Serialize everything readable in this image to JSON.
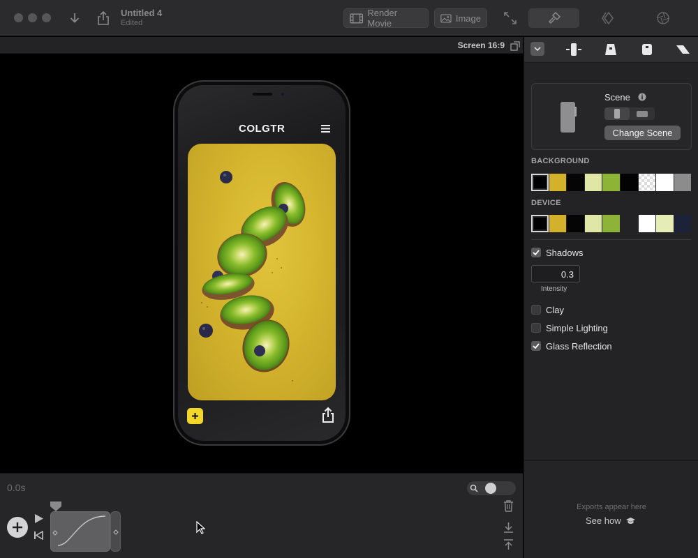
{
  "window": {
    "title": "Untitled 4",
    "status": "Edited"
  },
  "toolbar": {
    "render_movie_label": "Render Movie",
    "image_label": "Image"
  },
  "canvas": {
    "aspect_label": "Screen 16:9"
  },
  "app_preview": {
    "logo_text": "COLGTR"
  },
  "timeline": {
    "time": "0.0s"
  },
  "sidebar": {
    "scene_label": "Scene",
    "change_scene_label": "Change Scene",
    "background_title": "BACKGROUND",
    "device_title": "DEVICE",
    "background_swatches": [
      "#000000",
      "#d4b12a",
      "#050505",
      "#dfe6a6",
      "#8db337",
      "#030303",
      "checker",
      "#ffffff",
      "#8c8c8c"
    ],
    "device_swatches": [
      "#000000",
      "#d4b12a",
      "#050505",
      "#dfe6a6",
      "#8db337",
      "#232325",
      "#ffffff",
      "#e6ecb6",
      "#1c2238"
    ],
    "options": {
      "shadows": {
        "label": "Shadows",
        "checked": true
      },
      "intensity_value": "0.3",
      "intensity_label": "Intensity",
      "clay": {
        "label": "Clay",
        "checked": false
      },
      "simple_lighting": {
        "label": "Simple Lighting",
        "checked": false
      },
      "glass_reflection": {
        "label": "Glass Reflection",
        "checked": true
      }
    },
    "exports_hint": "Exports appear here",
    "see_how_label": "See how"
  },
  "colors": {
    "accent_yellow": "#f2d62a",
    "kiwi_green": "#7fb22e"
  }
}
